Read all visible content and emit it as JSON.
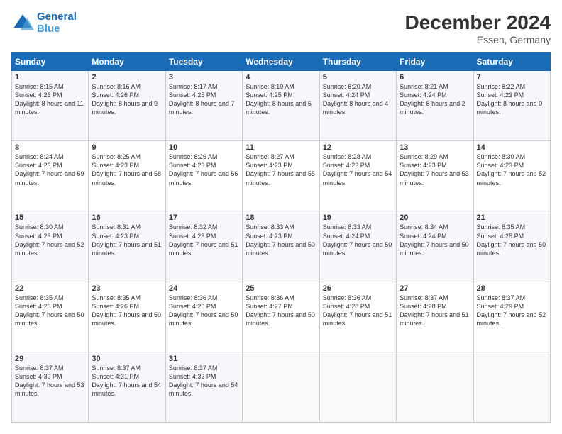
{
  "header": {
    "logo_line1": "General",
    "logo_line2": "Blue",
    "month": "December 2024",
    "location": "Essen, Germany"
  },
  "weekdays": [
    "Sunday",
    "Monday",
    "Tuesday",
    "Wednesday",
    "Thursday",
    "Friday",
    "Saturday"
  ],
  "weeks": [
    [
      {
        "day": "1",
        "sunrise": "8:15 AM",
        "sunset": "4:26 PM",
        "daylight": "8 hours and 11 minutes."
      },
      {
        "day": "2",
        "sunrise": "8:16 AM",
        "sunset": "4:26 PM",
        "daylight": "8 hours and 9 minutes."
      },
      {
        "day": "3",
        "sunrise": "8:17 AM",
        "sunset": "4:25 PM",
        "daylight": "8 hours and 7 minutes."
      },
      {
        "day": "4",
        "sunrise": "8:19 AM",
        "sunset": "4:25 PM",
        "daylight": "8 hours and 5 minutes."
      },
      {
        "day": "5",
        "sunrise": "8:20 AM",
        "sunset": "4:24 PM",
        "daylight": "8 hours and 4 minutes."
      },
      {
        "day": "6",
        "sunrise": "8:21 AM",
        "sunset": "4:24 PM",
        "daylight": "8 hours and 2 minutes."
      },
      {
        "day": "7",
        "sunrise": "8:22 AM",
        "sunset": "4:23 PM",
        "daylight": "8 hours and 0 minutes."
      }
    ],
    [
      {
        "day": "8",
        "sunrise": "8:24 AM",
        "sunset": "4:23 PM",
        "daylight": "7 hours and 59 minutes."
      },
      {
        "day": "9",
        "sunrise": "8:25 AM",
        "sunset": "4:23 PM",
        "daylight": "7 hours and 58 minutes."
      },
      {
        "day": "10",
        "sunrise": "8:26 AM",
        "sunset": "4:23 PM",
        "daylight": "7 hours and 56 minutes."
      },
      {
        "day": "11",
        "sunrise": "8:27 AM",
        "sunset": "4:23 PM",
        "daylight": "7 hours and 55 minutes."
      },
      {
        "day": "12",
        "sunrise": "8:28 AM",
        "sunset": "4:23 PM",
        "daylight": "7 hours and 54 minutes."
      },
      {
        "day": "13",
        "sunrise": "8:29 AM",
        "sunset": "4:23 PM",
        "daylight": "7 hours and 53 minutes."
      },
      {
        "day": "14",
        "sunrise": "8:30 AM",
        "sunset": "4:23 PM",
        "daylight": "7 hours and 52 minutes."
      }
    ],
    [
      {
        "day": "15",
        "sunrise": "8:30 AM",
        "sunset": "4:23 PM",
        "daylight": "7 hours and 52 minutes."
      },
      {
        "day": "16",
        "sunrise": "8:31 AM",
        "sunset": "4:23 PM",
        "daylight": "7 hours and 51 minutes."
      },
      {
        "day": "17",
        "sunrise": "8:32 AM",
        "sunset": "4:23 PM",
        "daylight": "7 hours and 51 minutes."
      },
      {
        "day": "18",
        "sunrise": "8:33 AM",
        "sunset": "4:23 PM",
        "daylight": "7 hours and 50 minutes."
      },
      {
        "day": "19",
        "sunrise": "8:33 AM",
        "sunset": "4:24 PM",
        "daylight": "7 hours and 50 minutes."
      },
      {
        "day": "20",
        "sunrise": "8:34 AM",
        "sunset": "4:24 PM",
        "daylight": "7 hours and 50 minutes."
      },
      {
        "day": "21",
        "sunrise": "8:35 AM",
        "sunset": "4:25 PM",
        "daylight": "7 hours and 50 minutes."
      }
    ],
    [
      {
        "day": "22",
        "sunrise": "8:35 AM",
        "sunset": "4:25 PM",
        "daylight": "7 hours and 50 minutes."
      },
      {
        "day": "23",
        "sunrise": "8:35 AM",
        "sunset": "4:26 PM",
        "daylight": "7 hours and 50 minutes."
      },
      {
        "day": "24",
        "sunrise": "8:36 AM",
        "sunset": "4:26 PM",
        "daylight": "7 hours and 50 minutes."
      },
      {
        "day": "25",
        "sunrise": "8:36 AM",
        "sunset": "4:27 PM",
        "daylight": "7 hours and 50 minutes."
      },
      {
        "day": "26",
        "sunrise": "8:36 AM",
        "sunset": "4:28 PM",
        "daylight": "7 hours and 51 minutes."
      },
      {
        "day": "27",
        "sunrise": "8:37 AM",
        "sunset": "4:28 PM",
        "daylight": "7 hours and 51 minutes."
      },
      {
        "day": "28",
        "sunrise": "8:37 AM",
        "sunset": "4:29 PM",
        "daylight": "7 hours and 52 minutes."
      }
    ],
    [
      {
        "day": "29",
        "sunrise": "8:37 AM",
        "sunset": "4:30 PM",
        "daylight": "7 hours and 53 minutes."
      },
      {
        "day": "30",
        "sunrise": "8:37 AM",
        "sunset": "4:31 PM",
        "daylight": "7 hours and 54 minutes."
      },
      {
        "day": "31",
        "sunrise": "8:37 AM",
        "sunset": "4:32 PM",
        "daylight": "7 hours and 54 minutes."
      },
      null,
      null,
      null,
      null
    ]
  ]
}
